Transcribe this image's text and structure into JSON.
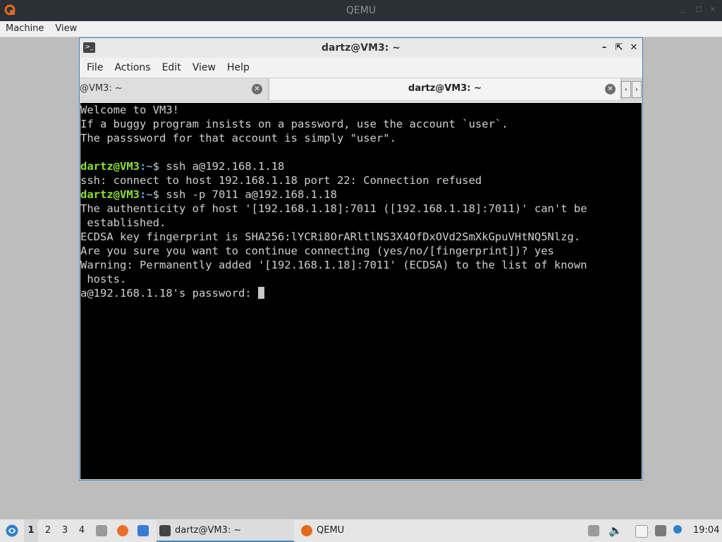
{
  "qemu": {
    "title": "QEMU",
    "menu": [
      "Machine",
      "View"
    ],
    "window_controls": [
      "_",
      "□",
      "×"
    ]
  },
  "terminal_window": {
    "title": "dartz@VM3: ~",
    "menu": [
      "File",
      "Actions",
      "Edit",
      "View",
      "Help"
    ],
    "tabs": [
      {
        "label": "@VM3: ~",
        "active": false
      },
      {
        "label": "dartz@VM3: ~",
        "active": true
      }
    ]
  },
  "terminal": {
    "lines": [
      {
        "text": "Welcome to VM3!"
      },
      {
        "text": "If a buggy program insists on a password, use the account `user`."
      },
      {
        "text": "The passsword for that account is simply \"user\"."
      },
      {
        "text": ""
      },
      {
        "prompt_user": "dartz@VM3",
        "prompt_path": ":~",
        "text": "$ ssh a@192.168.1.18"
      },
      {
        "text": "ssh: connect to host 192.168.1.18 port 22: Connection refused"
      },
      {
        "prompt_user": "dartz@VM3",
        "prompt_path": ":~",
        "text": "$ ssh -p 7011 a@192.168.1.18"
      },
      {
        "text": "The authenticity of host '[192.168.1.18]:7011 ([192.168.1.18]:7011)' can't be"
      },
      {
        "text": " established."
      },
      {
        "text": "ECDSA key fingerprint is SHA256:lYCRi8OrARltlNS3X4OfDxOVd2SmXkGpuVHtNQ5Nlzg."
      },
      {
        "text": "Are you sure you want to continue connecting (yes/no/[fingerprint])? yes"
      },
      {
        "text": "Warning: Permanently added '[192.168.1.18]:7011' (ECDSA) to the list of known"
      },
      {
        "text": " hosts."
      },
      {
        "text": "a@192.168.1.18's password: ",
        "cursor": true
      }
    ]
  },
  "taskbar": {
    "workspaces": [
      "1",
      "2",
      "3",
      "4"
    ],
    "tasks": [
      {
        "label": "dartz@VM3: ~",
        "active": true
      },
      {
        "label": "QEMU",
        "active": false
      }
    ],
    "clock": "19:04",
    "accent": "#3a86c8"
  }
}
